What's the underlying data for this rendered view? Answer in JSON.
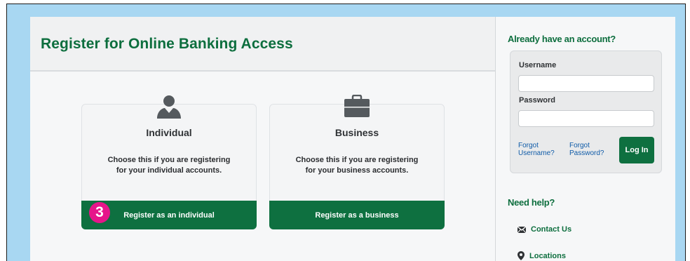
{
  "header": {
    "title": "Register for Online Banking Access"
  },
  "cards": [
    {
      "icon": "person-icon",
      "title": "Individual",
      "desc_line1": "Choose this if you are registering",
      "desc_line2": "for your individual accounts.",
      "button": "Register as an individual"
    },
    {
      "icon": "briefcase-icon",
      "title": "Business",
      "desc_line1": "Choose this if you are registering",
      "desc_line2": "for your business accounts.",
      "button": "Register as a business"
    }
  ],
  "step_badge": "3",
  "login": {
    "title": "Already have an account?",
    "username_label": "Username",
    "username_value": "",
    "password_label": "Password",
    "password_value": "",
    "forgot_username_1": "Forgot",
    "forgot_username_2": "Username?",
    "forgot_password_1": "Forgot",
    "forgot_password_2": "Password?",
    "button": "Log In"
  },
  "help": {
    "title": "Need help?",
    "links": [
      {
        "icon": "envelope-icon",
        "label": "Contact Us"
      },
      {
        "icon": "location-pin-icon",
        "label": "Locations"
      }
    ]
  },
  "colors": {
    "brand_green": "#0e7040",
    "accent_pink": "#e6158a",
    "link_blue": "#0e5aa7",
    "frame_blue": "#a8d7f2"
  }
}
